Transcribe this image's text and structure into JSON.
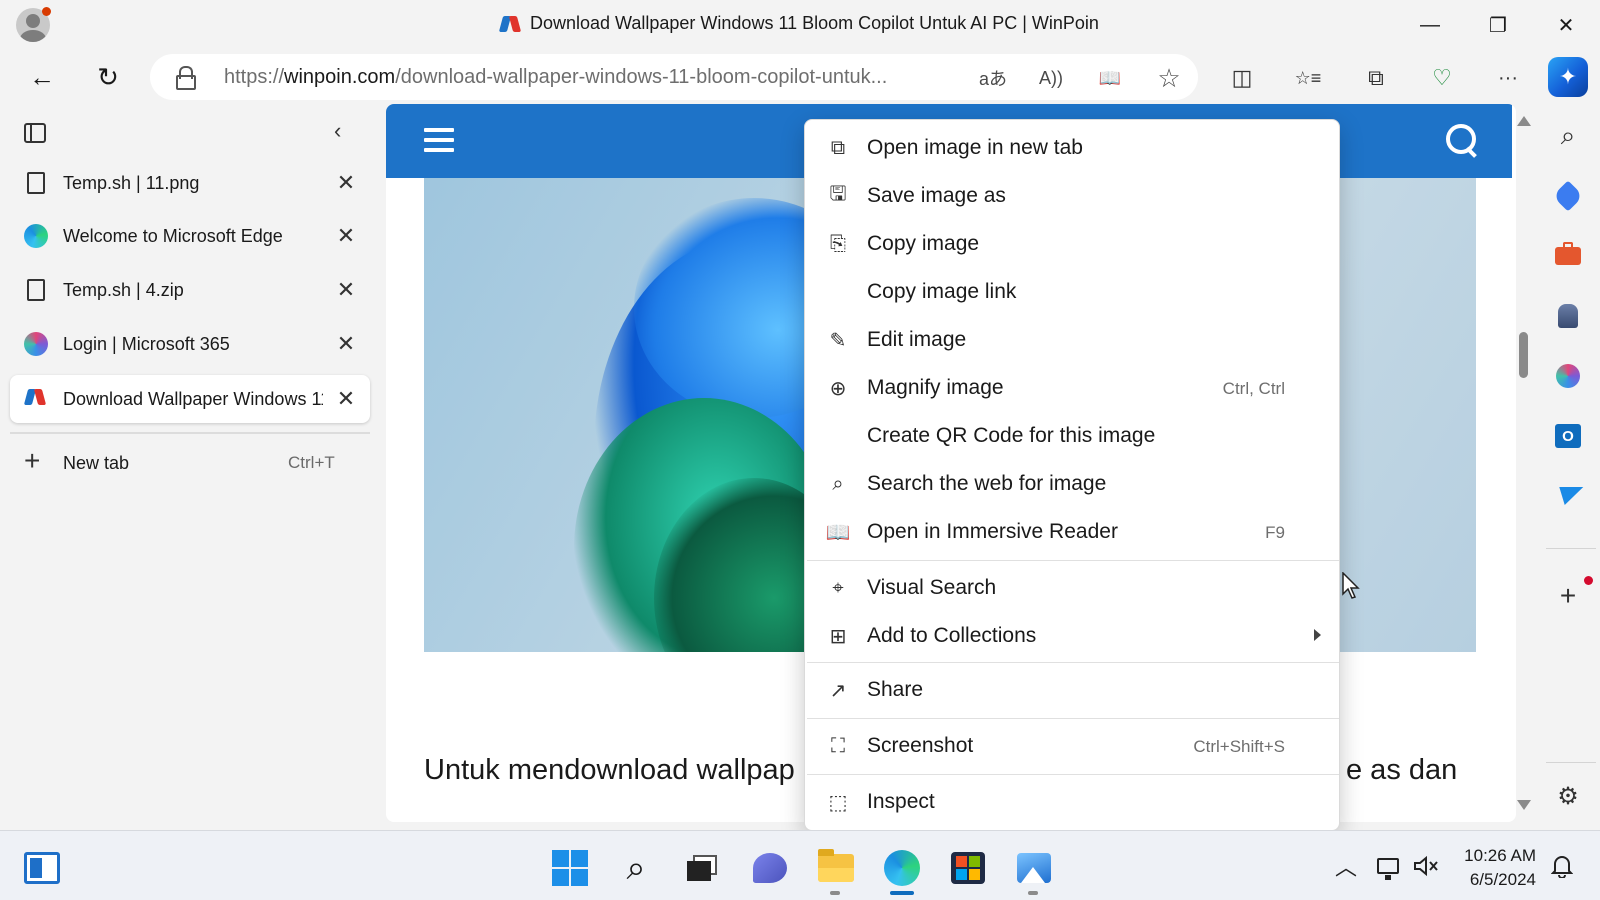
{
  "window": {
    "title": "Download Wallpaper Windows 11 Bloom Copilot Untuk AI PC | WinPoin",
    "minimize_glyph": "—",
    "restore_glyph": "❐",
    "close_glyph": "✕"
  },
  "address_bar": {
    "url_prefix": "https://",
    "url_domain": "winpoin.com",
    "url_path": "/download-wallpaper-windows-11-bloom-copilot-untuk...",
    "translate_glyph": "aあ",
    "read_aloud_glyph": "A))",
    "immersive_glyph": "📖",
    "favorite_glyph": "☆"
  },
  "toolbar": {
    "back_glyph": "←",
    "refresh_glyph": "↻",
    "split_glyph": "◫",
    "favorites_glyph": "☆≡",
    "collections_glyph": "⧉",
    "health_glyph": "♡",
    "more_glyph": "···",
    "copilot_glyph": "✦"
  },
  "tabs_panel": {
    "collapse_glyph": "‹",
    "close_glyph": "✕",
    "tabs": [
      {
        "label": "Temp.sh | 11.png",
        "icon": "file-icon"
      },
      {
        "label": "Welcome to Microsoft Edge",
        "icon": "edge-icon"
      },
      {
        "label": "Temp.sh | 4.zip",
        "icon": "file-icon"
      },
      {
        "label": "Login | Microsoft 365",
        "icon": "m365-icon"
      },
      {
        "label": "Download Wallpaper Windows 11 Bloom Copilot Untuk AI PC | WinPoin",
        "icon": "winpoin-icon",
        "active": true
      }
    ],
    "new_tab": {
      "plus_glyph": "+",
      "label": "New tab",
      "shortcut": "Ctrl+T"
    }
  },
  "page": {
    "article_left": "Untuk mendownload wallpap",
    "article_right": "e as dan"
  },
  "context_menu": {
    "items": [
      {
        "label": "Open image in new tab",
        "icon": "open-new-tab-icon",
        "glyph": "⧉",
        "shortcut": ""
      },
      {
        "label": "Save image as",
        "icon": "save-image-icon",
        "glyph": "🖫",
        "shortcut": ""
      },
      {
        "label": "Copy image",
        "icon": "copy-image-icon",
        "glyph": "⎘",
        "shortcut": ""
      },
      {
        "label": "Copy image link",
        "icon": "",
        "glyph": "",
        "shortcut": ""
      },
      {
        "label": "Edit image",
        "icon": "edit-image-icon",
        "glyph": "✎",
        "shortcut": ""
      },
      {
        "label": "Magnify image",
        "icon": "magnify-icon",
        "glyph": "⊕",
        "shortcut": "Ctrl, Ctrl"
      },
      {
        "label": "Create QR Code for this image",
        "icon": "",
        "glyph": "",
        "shortcut": ""
      },
      {
        "label": "Search the web for image",
        "icon": "search-image-icon",
        "glyph": "⌕",
        "shortcut": ""
      },
      {
        "label": "Open in Immersive Reader",
        "icon": "immersive-reader-icon",
        "glyph": "📖",
        "shortcut": "F9"
      },
      {
        "label": "Visual Search",
        "icon": "visual-search-icon",
        "glyph": "⌖",
        "shortcut": ""
      },
      {
        "label": "Add to Collections",
        "icon": "collections-icon",
        "glyph": "⊞",
        "shortcut": "",
        "submenu": true
      },
      {
        "label": "Share",
        "icon": "share-icon",
        "glyph": "↗",
        "shortcut": ""
      },
      {
        "label": "Screenshot",
        "icon": "screenshot-icon",
        "glyph": "⛶",
        "shortcut": "Ctrl+Shift+S"
      },
      {
        "label": "Inspect",
        "icon": "inspect-icon",
        "glyph": "⬚",
        "shortcut": ""
      }
    ]
  },
  "right_sidebar": {
    "search_glyph": "⌕",
    "add_glyph": "+",
    "settings_glyph": "⚙"
  },
  "taskbar": {
    "time": "10:26 AM",
    "date": "6/5/2024",
    "tray_chevron_glyph": "︿",
    "search_glyph": "⌕"
  },
  "colors": {
    "site_header": "#1e73c8",
    "accent": "#0f6cbd"
  }
}
